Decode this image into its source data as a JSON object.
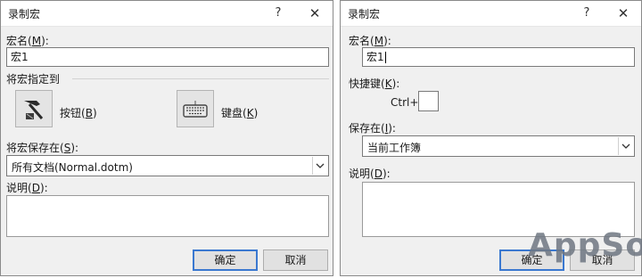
{
  "left_dialog": {
    "title": "录制宏",
    "help_glyph": "?",
    "close_glyph": "✕",
    "macro_name_label": "宏名",
    "macro_name_hotkey": "M",
    "macro_name_value": "宏1",
    "assign_label": "将宏指定到",
    "button_option_label": "按钮",
    "button_option_hotkey": "B",
    "keyboard_option_label": "键盘",
    "keyboard_option_hotkey": "K",
    "store_in_label": "将宏保存在",
    "store_in_hotkey": "S",
    "store_in_value": "所有文档(Normal.dotm)",
    "description_label": "说明",
    "description_hotkey": "D",
    "ok_label": "确定",
    "cancel_label": "取消"
  },
  "right_dialog": {
    "title": "录制宏",
    "help_glyph": "?",
    "close_glyph": "✕",
    "macro_name_label": "宏名",
    "macro_name_hotkey": "M",
    "macro_name_value": "宏1",
    "shortcut_label": "快捷键",
    "shortcut_hotkey": "K",
    "ctrl_prefix": "Ctrl+",
    "store_in_label": "保存在",
    "store_in_hotkey": "I",
    "store_in_value": "当前工作簿",
    "description_label": "说明",
    "description_hotkey": "D",
    "ok_label": "确定",
    "cancel_label": "取消"
  },
  "watermark": {
    "text": "AppSo"
  },
  "colors": {
    "dialog_bg": "#f0f0f0",
    "default_button_border": "#3a78d0"
  }
}
